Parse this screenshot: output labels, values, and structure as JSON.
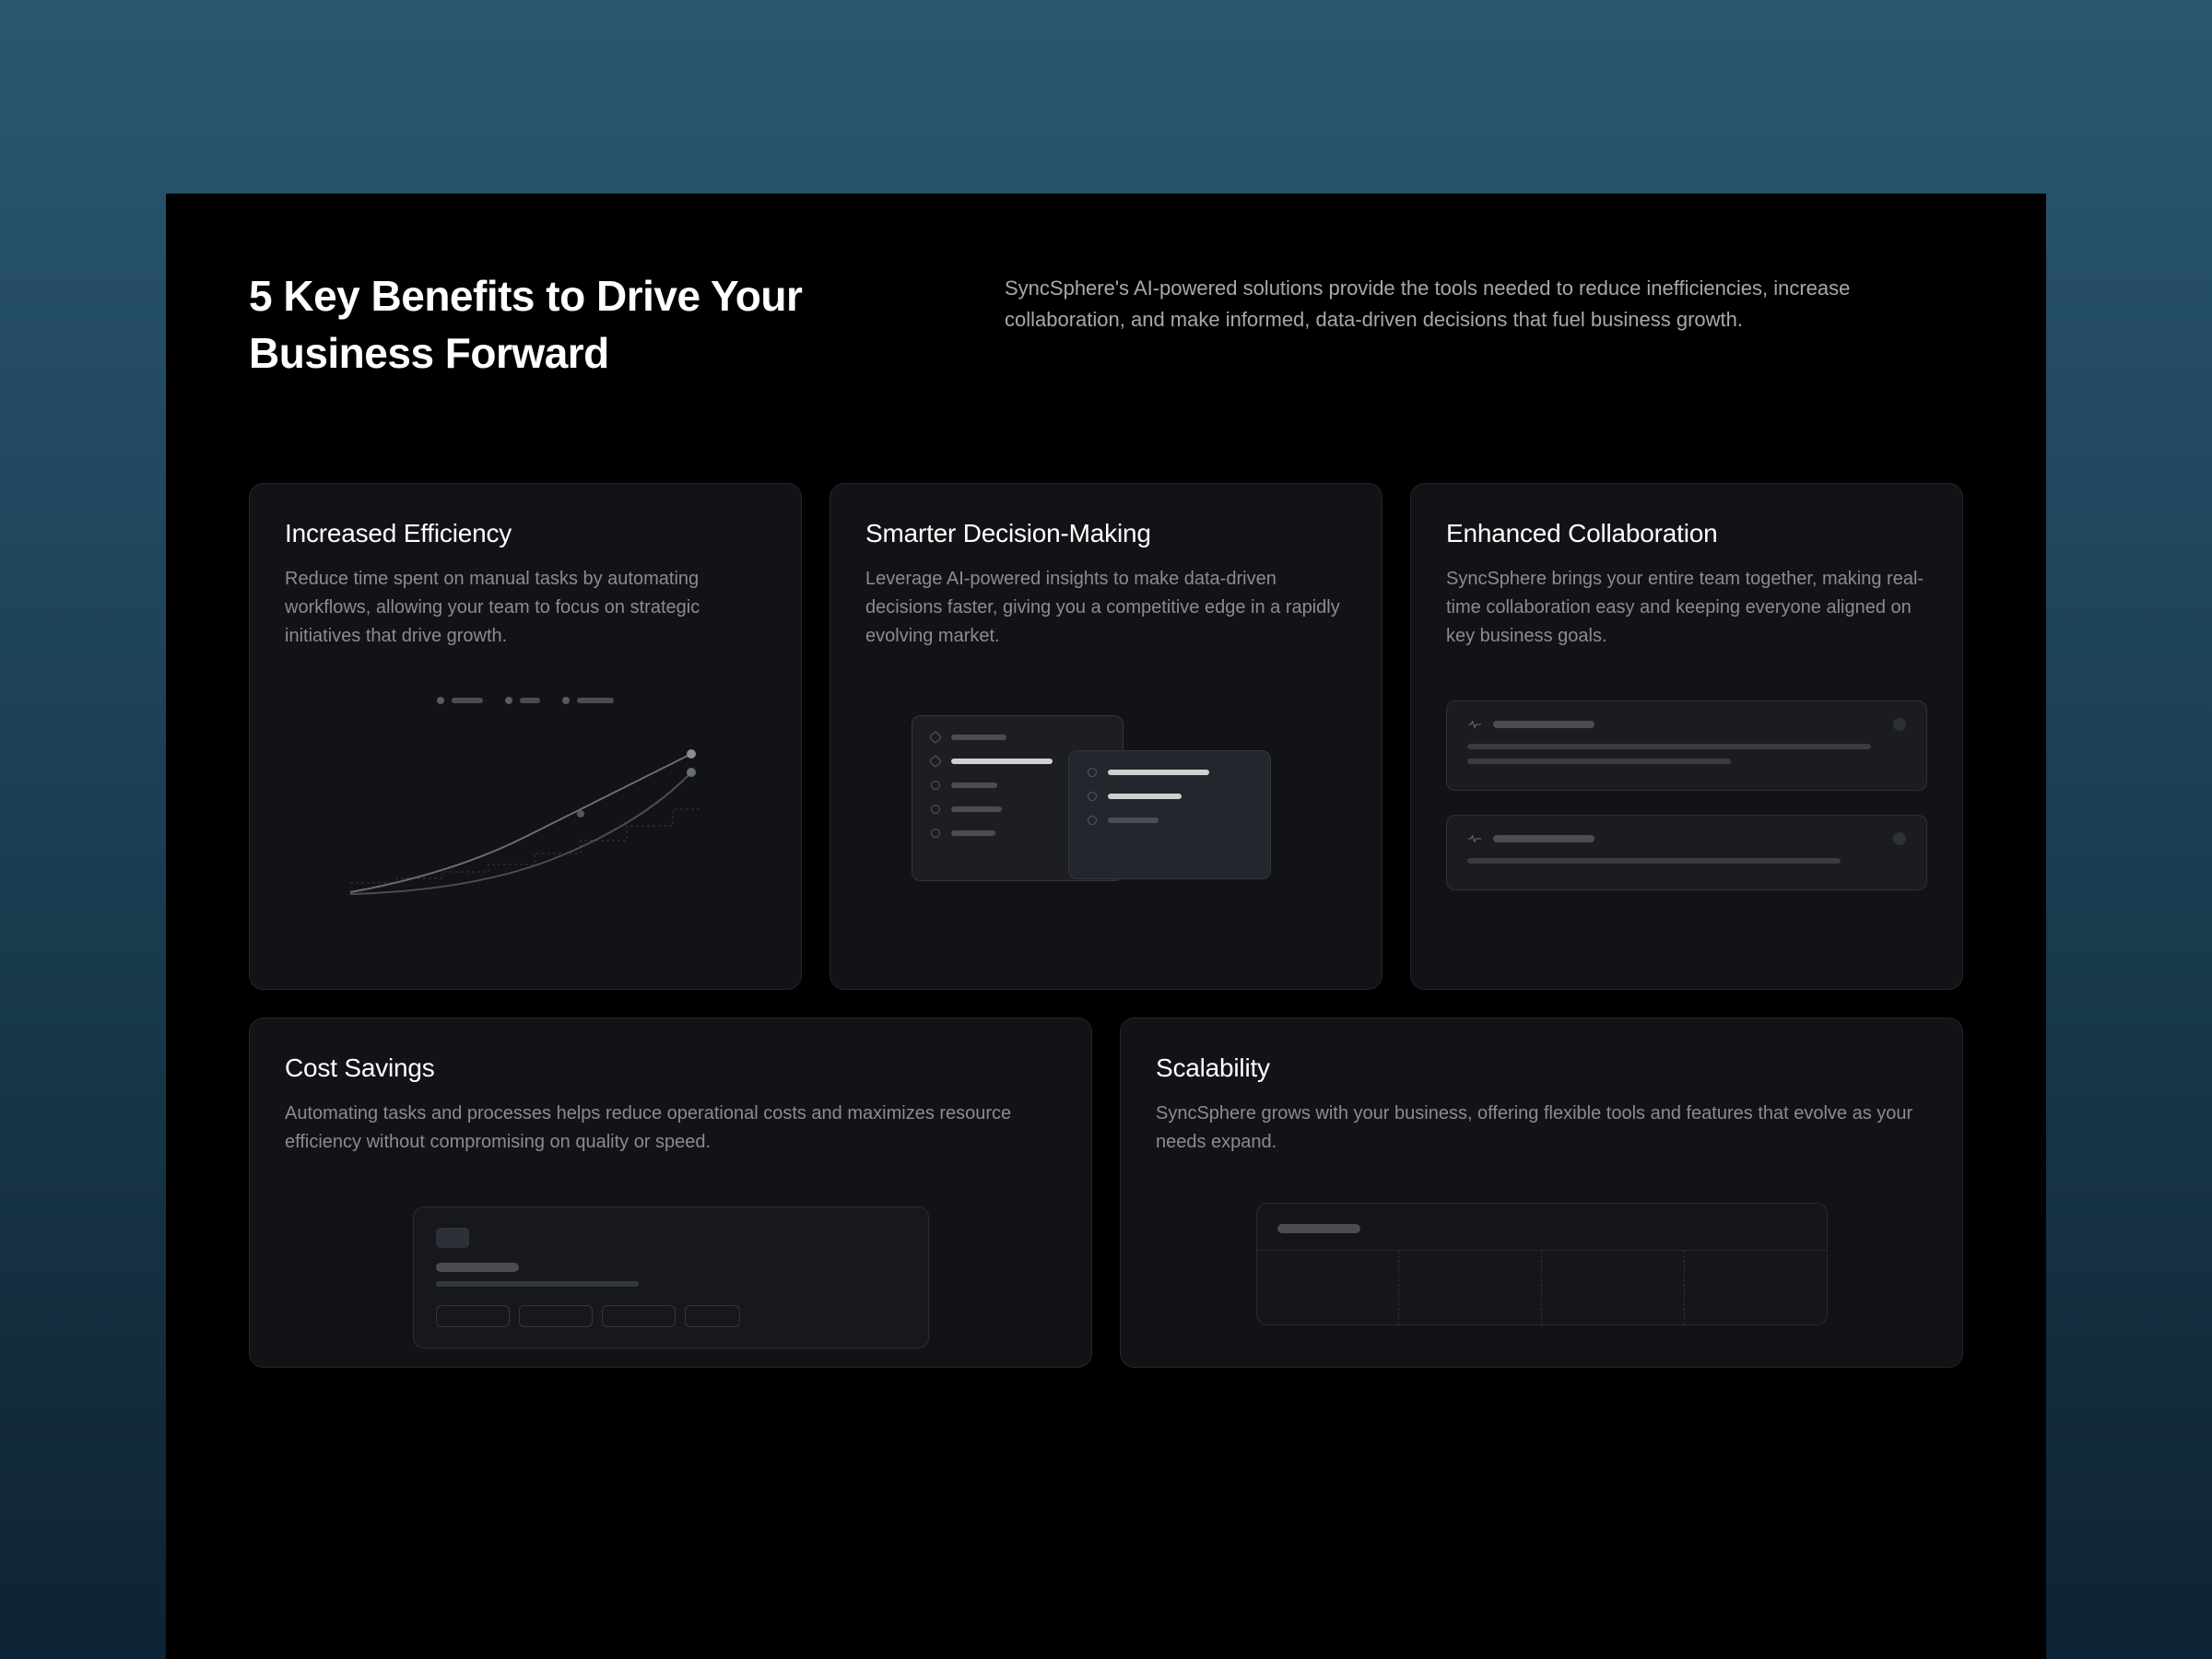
{
  "header": {
    "title": "5 Key Benefits to Drive Your Business Forward",
    "subtitle": "SyncSphere's AI-powered solutions provide the tools needed to reduce inefficiencies, increase collaboration, and make informed, data-driven decisions that fuel business growth."
  },
  "cards": [
    {
      "title": "Increased Efficiency",
      "desc": "Reduce time spent on manual tasks by automating workflows, allowing your team to focus on strategic initiatives that drive growth."
    },
    {
      "title": "Smarter Decision-Making",
      "desc": "Leverage AI-powered insights to make data-driven decisions faster, giving you a competitive edge in a rapidly evolving market."
    },
    {
      "title": "Enhanced Collaboration",
      "desc": "SyncSphere brings your entire team together, making real-time collaboration easy and keeping everyone aligned on key business goals."
    },
    {
      "title": "Cost Savings",
      "desc": "Automating tasks and processes helps reduce operational costs and maximizes resource efficiency without compromising on quality or speed."
    },
    {
      "title": "Scalability",
      "desc": "SyncSphere grows with your business, offering flexible tools and features that evolve as your needs expand."
    }
  ]
}
